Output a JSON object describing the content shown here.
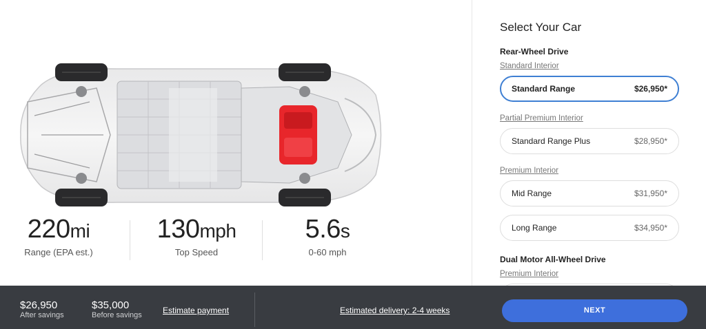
{
  "specs": [
    {
      "value": "220",
      "unit": "mi",
      "label": "Range (EPA est.)"
    },
    {
      "value": "130",
      "unit": "mph",
      "label": "Top Speed"
    },
    {
      "value": "5.6",
      "unit": "s",
      "label": "0-60 mph"
    }
  ],
  "panel": {
    "title": "Select Your Car",
    "rwd": {
      "heading": "Rear-Wheel Drive",
      "standard_interior": "Standard Interior",
      "partial_interior": "Partial Premium Interior",
      "premium_interior": "Premium Interior",
      "options": [
        {
          "name": "Standard Range",
          "price": "$26,950*",
          "selected": true
        },
        {
          "name": "Standard Range Plus",
          "price": "$28,950*",
          "selected": false
        },
        {
          "name": "Mid Range",
          "price": "$31,950*",
          "selected": false
        },
        {
          "name": "Long Range",
          "price": "$34,950*",
          "selected": false
        }
      ]
    },
    "awd": {
      "heading": "Dual Motor All-Wheel Drive",
      "premium_interior": "Premium Interior"
    }
  },
  "footer": {
    "after_savings_price": "$26,950",
    "after_savings_label": "After savings",
    "before_savings_price": "$35,000",
    "before_savings_label": "Before savings",
    "estimate_payment": "Estimate payment",
    "delivery": "Estimated delivery: 2-4 weeks",
    "next": "NEXT"
  },
  "colors": {
    "accent": "#3e7fd3",
    "next_button": "#3e6fdc",
    "footer_bg": "#393c41",
    "motor": "#e8262b"
  }
}
